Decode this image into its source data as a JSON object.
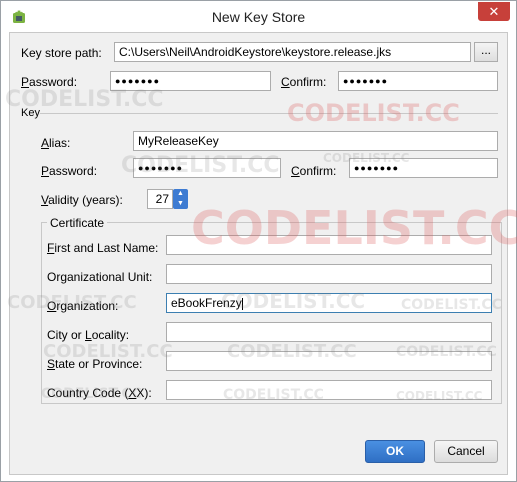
{
  "window": {
    "title": "New Key Store",
    "close_symbol": "✕"
  },
  "keystore": {
    "path_label": "Key store path:",
    "path_value": "C:\\Users\\Neil\\AndroidKeystore\\keystore.release.jks",
    "browse_label": "...",
    "password_label": "Password:",
    "password_value": "●●●●●●●",
    "confirm_label": "Confirm:",
    "confirm_value": "●●●●●●●"
  },
  "key": {
    "section_label": "Key",
    "alias_label": "Alias:",
    "alias_value": "MyReleaseKey",
    "password_label": "Password:",
    "password_value": "●●●●●●●",
    "confirm_label": "Confirm:",
    "confirm_value": "●●●●●●●",
    "validity_label": "Validity (years):",
    "validity_value": "27"
  },
  "certificate": {
    "legend": "Certificate",
    "name_label": "First and Last Name:",
    "name_value": "",
    "unit_label": "Organizational Unit:",
    "unit_value": "",
    "org_label": "Organization:",
    "org_value": "eBookFrenzy",
    "city_label": "City or Locality:",
    "city_value": "",
    "state_label": "State or Province:",
    "state_value": "",
    "country_label": "Country Code (XX):",
    "country_value": ""
  },
  "buttons": {
    "ok": "OK",
    "cancel": "Cancel"
  },
  "watermarks": [
    "CODELIST.CC",
    "CODELIST.CC",
    "CODELIST.CC",
    "CODELIST.CC",
    "CODELIST.CC",
    "CODELIST.CC",
    "CODELIST.CC",
    "CODELIST.CC",
    "CODELIST.CC",
    "CODELIST.CC",
    "CODELIST.CC",
    "CODELIST.CC",
    "CODELIST.CC",
    "CODELIST.CC"
  ],
  "colors": {
    "accent": "#3d7bd2",
    "close": "#c7403a"
  }
}
